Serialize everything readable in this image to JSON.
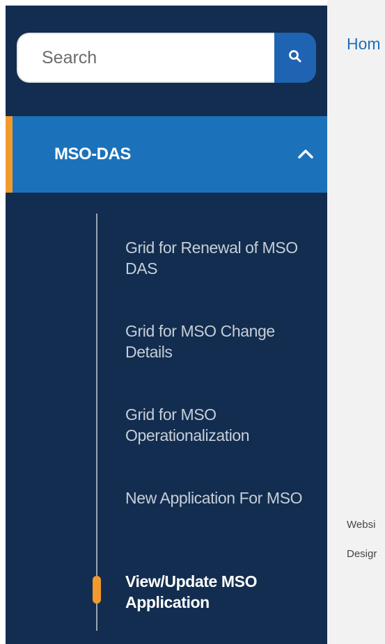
{
  "search": {
    "placeholder": "Search",
    "button_icon": "search-icon"
  },
  "menu": {
    "section_label": "MSO-DAS",
    "section_icon": "chevron-up-icon",
    "items": [
      {
        "label": "Grid for Renewal of MSO DAS",
        "active": false
      },
      {
        "label": "Grid for MSO Change Details",
        "active": false
      },
      {
        "label": "Grid for MSO Operationalization",
        "active": false
      },
      {
        "label": "New Application For MSO",
        "active": false
      },
      {
        "label": "View/Update MSO Application",
        "active": true
      }
    ]
  },
  "breadcrumb": {
    "home": "Hom"
  },
  "footer": {
    "line1": "Websi",
    "line2": "Desigr"
  },
  "colors": {
    "sidebar_bg": "#122d4f",
    "section_bg": "#1b72bb",
    "accent": "#f29a2e",
    "link": "#1f6fb8",
    "content_bg": "#f2f2f2"
  }
}
